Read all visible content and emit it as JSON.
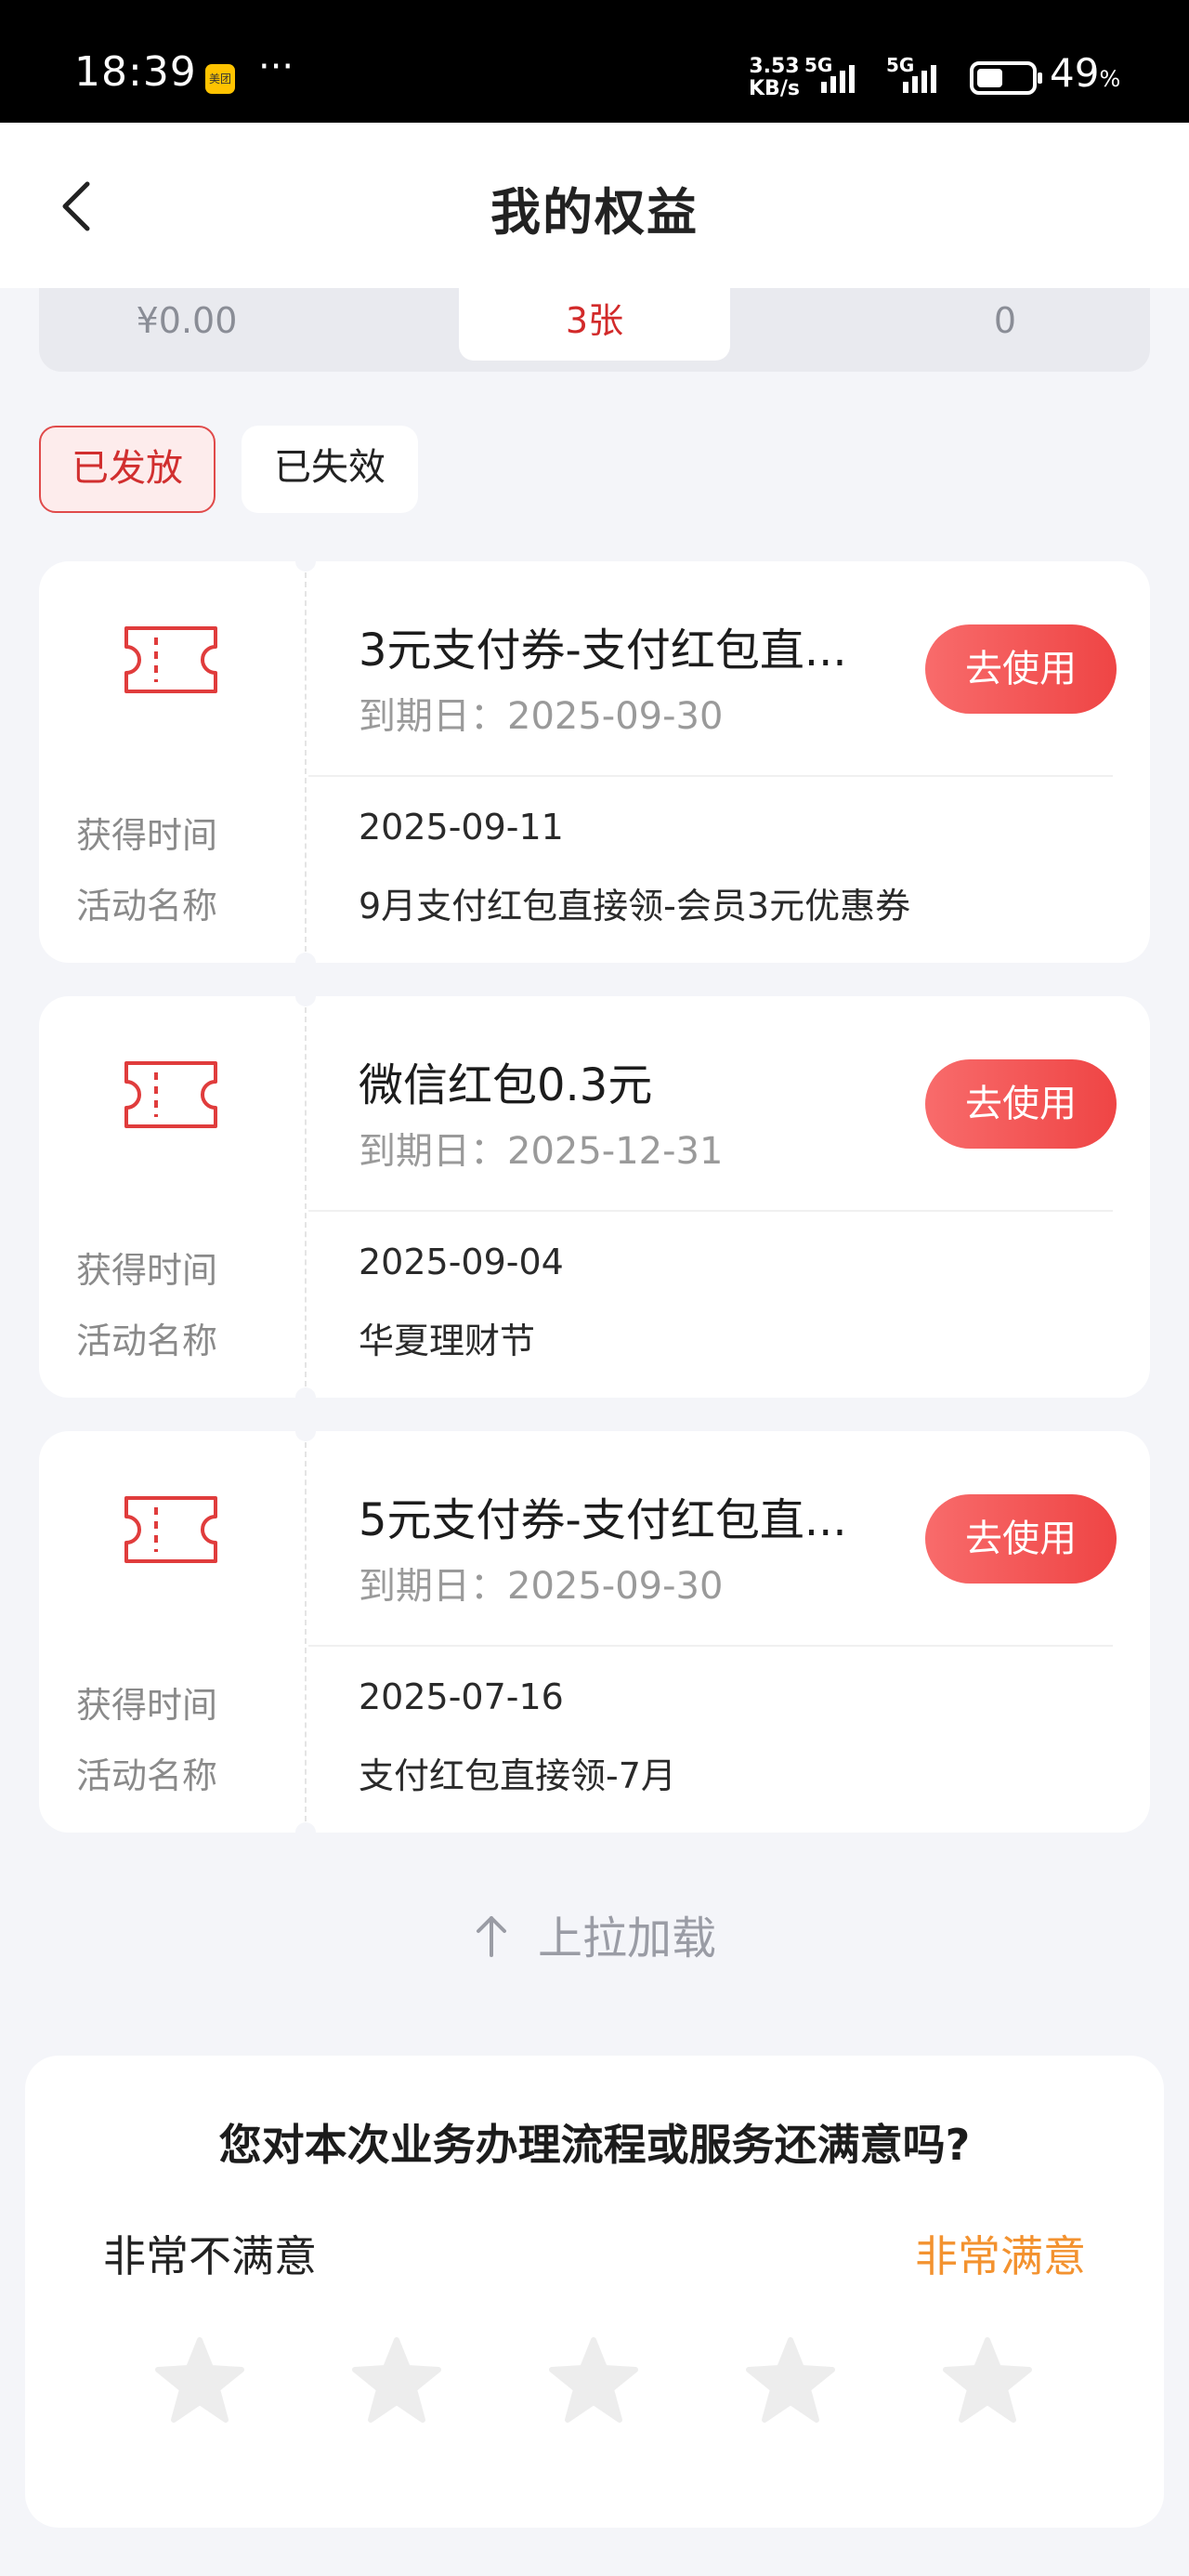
{
  "status_bar": {
    "time": "18:39",
    "app_badge": "美团",
    "dots": "···",
    "speed_top": "3.53",
    "speed_unit": "KB/s",
    "network1": "5G",
    "network2": "5G",
    "battery_level": 0.49,
    "battery_text": "49",
    "battery_unit": "%"
  },
  "header": {
    "title": "我的权益",
    "back_icon": "chevron-left-icon"
  },
  "summary": {
    "items": [
      {
        "label": "¥0.00"
      },
      {
        "label": "3张"
      },
      {
        "label": "0"
      }
    ],
    "active_index": 1
  },
  "filters": {
    "items": [
      {
        "label": "已发放"
      },
      {
        "label": "已失效"
      }
    ],
    "active_index": 0
  },
  "labels": {
    "received_time": "获得时间",
    "activity_name": "活动名称",
    "use_button": "去使用",
    "expiry_prefix": "到期日："
  },
  "coupons": [
    {
      "title": "3元支付券-支付红包直...",
      "expiry": "到期日：2025-09-30",
      "received_time": "2025-09-11",
      "activity_name": "9月支付红包直接领-会员3元优惠券"
    },
    {
      "title": "微信红包0.3元",
      "expiry": "到期日：2025-12-31",
      "received_time": "2025-09-04",
      "activity_name": "华夏理财节"
    },
    {
      "title": "5元支付券-支付红包直...",
      "expiry": "到期日：2025-09-30",
      "received_time": "2025-07-16",
      "activity_name": "支付红包直接领-7月"
    }
  ],
  "load_more": {
    "label": "上拉加载",
    "icon": "arrow-up-icon"
  },
  "survey": {
    "question": "您对本次业务办理流程或服务还满意吗?",
    "low_label": "非常不满意",
    "high_label": "非常满意",
    "star_count": 5,
    "rating": 0
  },
  "colors": {
    "accent_red": "#e84848",
    "survey_orange": "#f3922f",
    "background": "#f4f5f9"
  }
}
